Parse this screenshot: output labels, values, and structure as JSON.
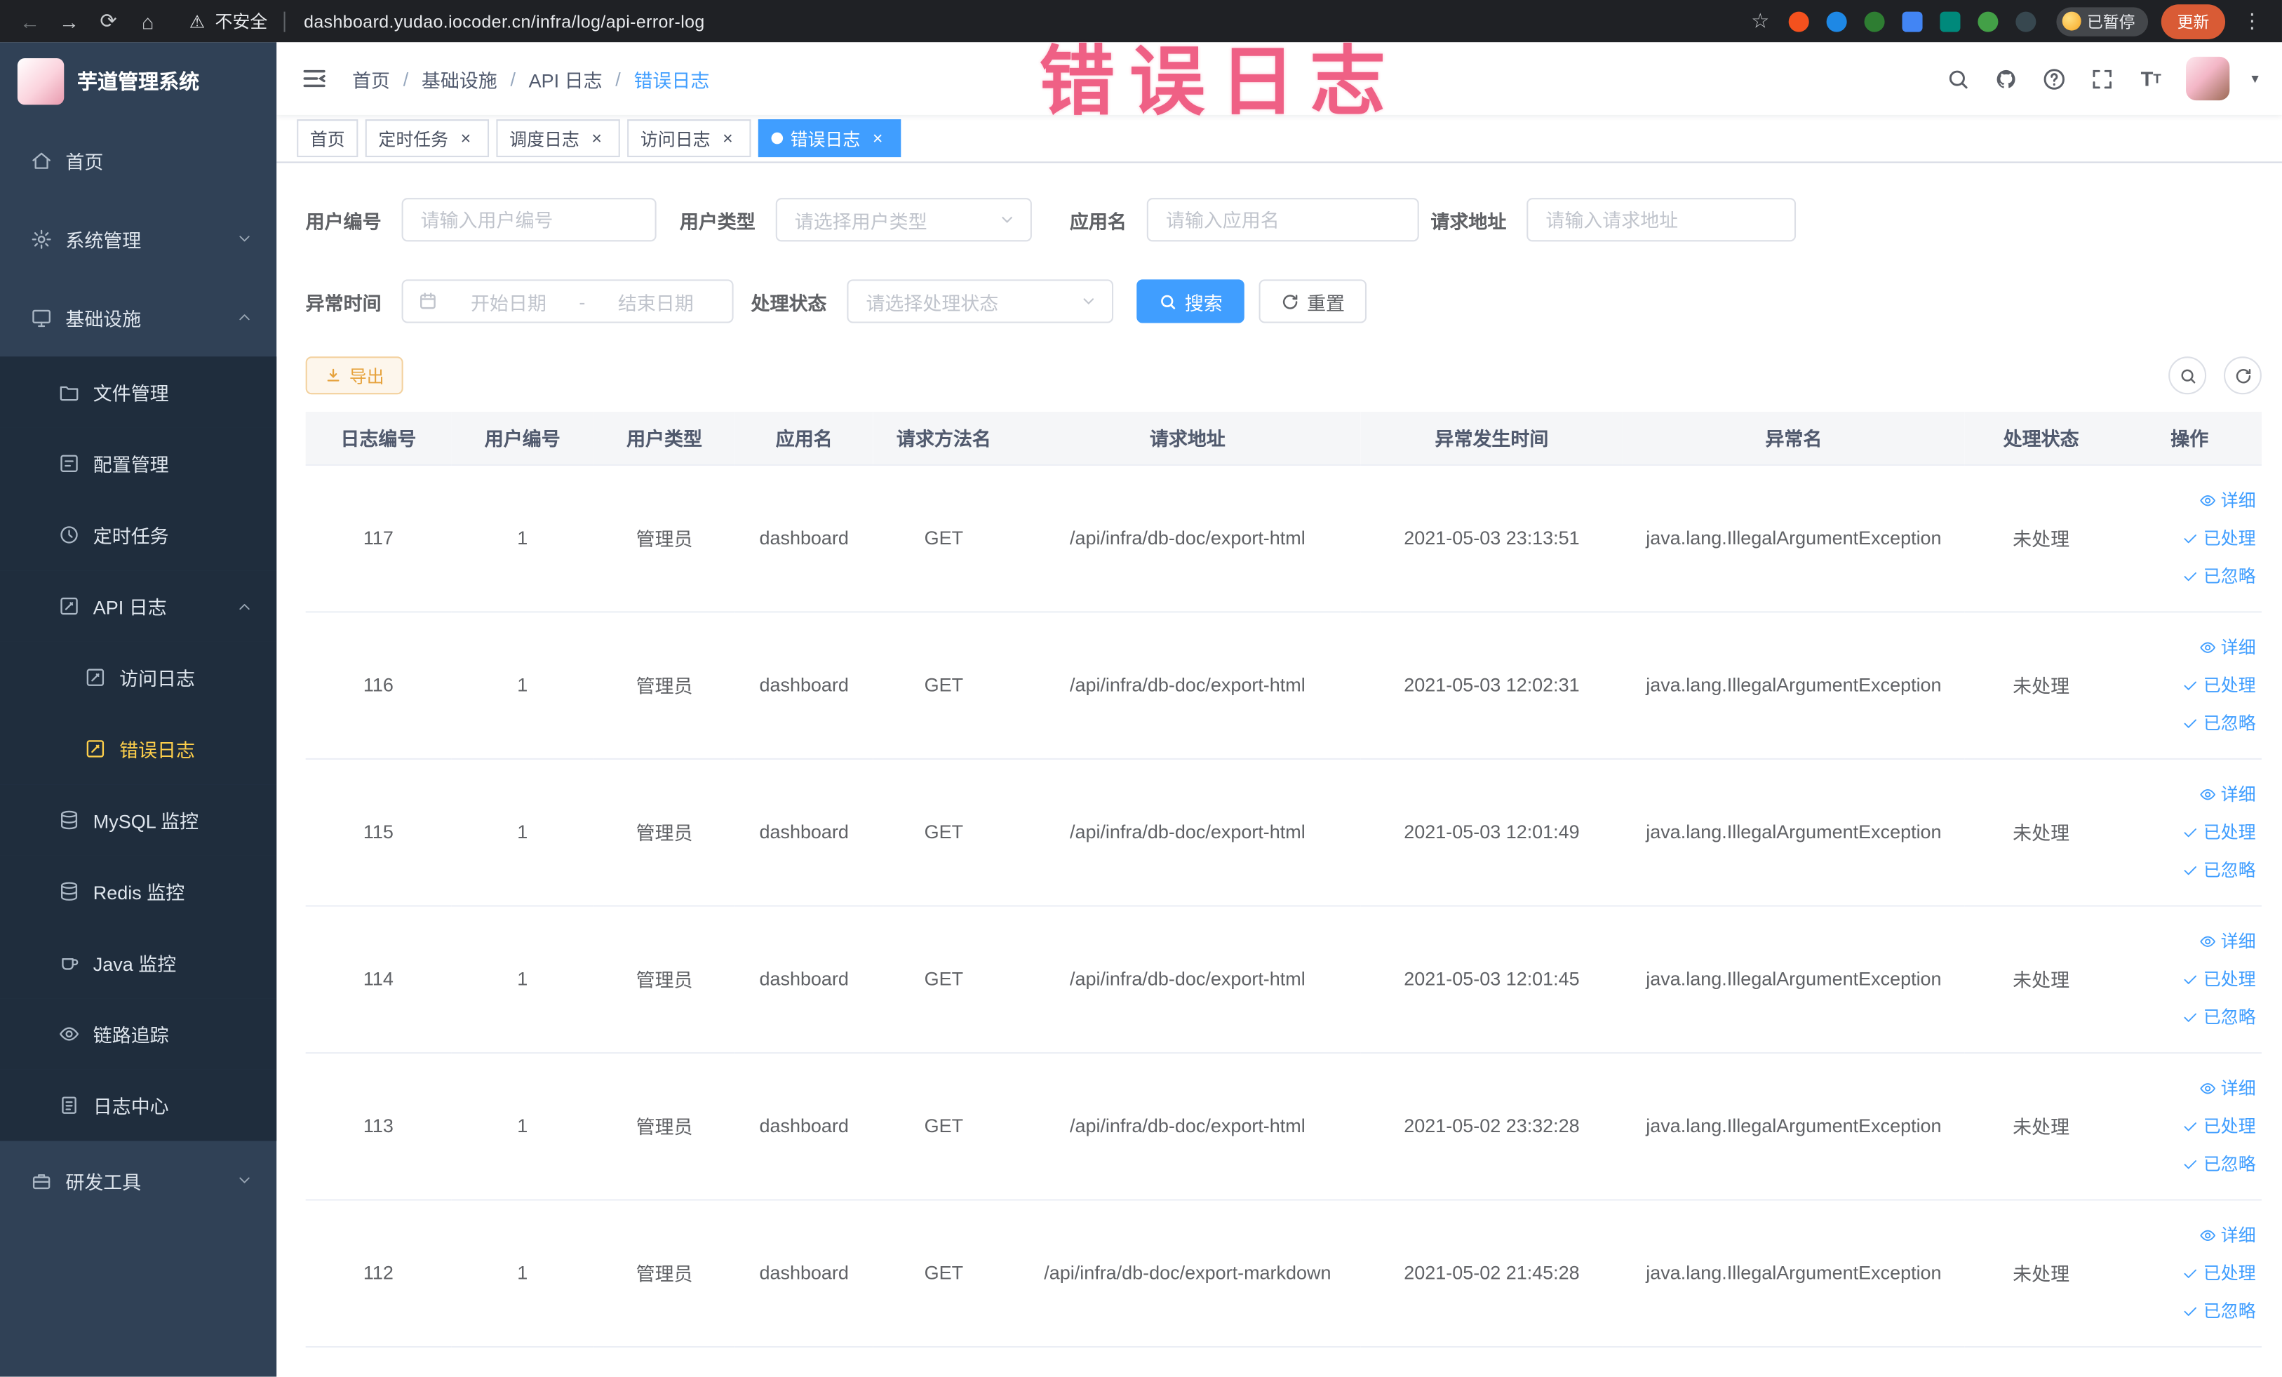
{
  "browser": {
    "security_label": "不安全",
    "url": "dashboard.yudao.iocoder.cn/infra/log/api-error-log",
    "paused_badge": "已暂停",
    "update_button": "更新"
  },
  "annotation": "错误日志",
  "colors": {
    "accent": "#409eff",
    "menu_active": "#ffd04b",
    "warning": "#e6a23c",
    "annotation_pink": "#ee537b",
    "sidebar_bg": "#304156",
    "submenu_bg": "#1f2d3d"
  },
  "sidebar": {
    "logo_title": "芋道管理系统",
    "items": [
      {
        "label": "首页",
        "icon": "home",
        "level": 1
      },
      {
        "label": "系统管理",
        "icon": "gear",
        "level": 1,
        "chevron": "down"
      },
      {
        "label": "基础设施",
        "icon": "infra",
        "level": 1,
        "chevron": "up"
      },
      {
        "label": "文件管理",
        "icon": "folder",
        "level": 2
      },
      {
        "label": "配置管理",
        "icon": "config",
        "level": 2
      },
      {
        "label": "定时任务",
        "icon": "clock",
        "level": 2
      },
      {
        "label": "API 日志",
        "icon": "edit",
        "level": 2,
        "chevron": "up"
      },
      {
        "label": "访问日志",
        "icon": "edit",
        "level": 3
      },
      {
        "label": "错误日志",
        "icon": "edit",
        "level": 3,
        "active": true
      },
      {
        "label": "MySQL 监控",
        "icon": "db",
        "level": 2
      },
      {
        "label": "Redis 监控",
        "icon": "db",
        "level": 2
      },
      {
        "label": "Java 监控",
        "icon": "java",
        "level": 2
      },
      {
        "label": "链路追踪",
        "icon": "eye",
        "level": 2
      },
      {
        "label": "日志中心",
        "icon": "doc",
        "level": 2
      },
      {
        "label": "研发工具",
        "icon": "tools",
        "level": 1,
        "chevron": "down"
      }
    ]
  },
  "navbar": {
    "breadcrumb": [
      "首页",
      "基础设施",
      "API 日志",
      "错误日志"
    ]
  },
  "tabs": [
    {
      "label": "首页",
      "closable": false,
      "active": false
    },
    {
      "label": "定时任务",
      "closable": true,
      "active": false
    },
    {
      "label": "调度日志",
      "closable": true,
      "active": false
    },
    {
      "label": "访问日志",
      "closable": true,
      "active": false
    },
    {
      "label": "错误日志",
      "closable": true,
      "active": true
    }
  ],
  "filters": {
    "user_id_label": "用户编号",
    "user_id_placeholder": "请输入用户编号",
    "user_type_label": "用户类型",
    "user_type_placeholder": "请选择用户类型",
    "app_name_label": "应用名",
    "app_name_placeholder": "请输入应用名",
    "request_url_label": "请求地址",
    "request_url_placeholder": "请输入请求地址",
    "exception_time_label": "异常时间",
    "start_date_placeholder": "开始日期",
    "range_separator": "-",
    "end_date_placeholder": "结束日期",
    "process_status_label": "处理状态",
    "process_status_placeholder": "请选择处理状态",
    "search_button": "搜索",
    "reset_button": "重置"
  },
  "toolbar": {
    "export_button": "导出"
  },
  "table": {
    "columns": [
      {
        "label": "日志编号",
        "key": "id"
      },
      {
        "label": "用户编号",
        "key": "user_id"
      },
      {
        "label": "用户类型",
        "key": "user_type"
      },
      {
        "label": "应用名",
        "key": "app_name"
      },
      {
        "label": "请求方法名",
        "key": "method"
      },
      {
        "label": "请求地址",
        "key": "url"
      },
      {
        "label": "异常发生时间",
        "key": "time"
      },
      {
        "label": "异常名",
        "key": "exception"
      },
      {
        "label": "处理状态",
        "key": "status"
      },
      {
        "label": "操作",
        "key": "actions"
      }
    ],
    "row_actions": [
      "详细",
      "已处理",
      "已忽略"
    ],
    "rows": [
      {
        "id": "117",
        "user_id": "1",
        "user_type": "管理员",
        "app_name": "dashboard",
        "method": "GET",
        "url": "/api/infra/db-doc/export-html",
        "time": "2021-05-03 23:13:51",
        "exception": "java.lang.IllegalArgumentException",
        "status": "未处理"
      },
      {
        "id": "116",
        "user_id": "1",
        "user_type": "管理员",
        "app_name": "dashboard",
        "method": "GET",
        "url": "/api/infra/db-doc/export-html",
        "time": "2021-05-03 12:02:31",
        "exception": "java.lang.IllegalArgumentException",
        "status": "未处理"
      },
      {
        "id": "115",
        "user_id": "1",
        "user_type": "管理员",
        "app_name": "dashboard",
        "method": "GET",
        "url": "/api/infra/db-doc/export-html",
        "time": "2021-05-03 12:01:49",
        "exception": "java.lang.IllegalArgumentException",
        "status": "未处理"
      },
      {
        "id": "114",
        "user_id": "1",
        "user_type": "管理员",
        "app_name": "dashboard",
        "method": "GET",
        "url": "/api/infra/db-doc/export-html",
        "time": "2021-05-03 12:01:45",
        "exception": "java.lang.IllegalArgumentException",
        "status": "未处理"
      },
      {
        "id": "113",
        "user_id": "1",
        "user_type": "管理员",
        "app_name": "dashboard",
        "method": "GET",
        "url": "/api/infra/db-doc/export-html",
        "time": "2021-05-02 23:32:28",
        "exception": "java.lang.IllegalArgumentException",
        "status": "未处理"
      },
      {
        "id": "112",
        "user_id": "1",
        "user_type": "管理员",
        "app_name": "dashboard",
        "method": "GET",
        "url": "/api/infra/db-doc/export-markdown",
        "time": "2021-05-02 21:45:28",
        "exception": "java.lang.IllegalArgumentException",
        "status": "未处理"
      }
    ]
  }
}
